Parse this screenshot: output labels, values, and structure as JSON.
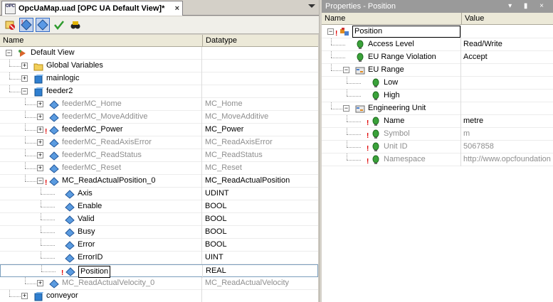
{
  "left_panel": {
    "tab_title": "OpcUaMap.uad [OPC UA Default View]*",
    "tab_close": "×",
    "opc_icon_text": "OPC",
    "columns": {
      "name": "Name",
      "datatype": "Datatype"
    },
    "toolbar": [
      "remove-icon",
      "add-icon",
      "tag-icon",
      "check-icon",
      "binoculars-icon"
    ],
    "tree": [
      {
        "name": "Default View",
        "type": "",
        "level": 0,
        "exp": "−",
        "icon": "view-icon",
        "warn": false,
        "dim": false
      },
      {
        "name": "Global Variables",
        "type": "",
        "level": 1,
        "exp": "+",
        "icon": "folder-icon",
        "warn": false,
        "dim": false
      },
      {
        "name": "mainlogic",
        "type": "",
        "level": 1,
        "exp": "+",
        "icon": "cube-icon",
        "warn": false,
        "dim": false
      },
      {
        "name": "feeder2",
        "type": "",
        "level": 1,
        "exp": "−",
        "icon": "cube-icon",
        "warn": false,
        "dim": false
      },
      {
        "name": "feederMC_Home",
        "type": "MC_Home",
        "level": 2,
        "exp": "+",
        "icon": "diamond-icon",
        "warn": false,
        "dim": true
      },
      {
        "name": "feederMC_MoveAdditive",
        "type": "MC_MoveAdditive",
        "level": 2,
        "exp": "+",
        "icon": "diamond-icon",
        "warn": false,
        "dim": true
      },
      {
        "name": "feederMC_Power",
        "type": "MC_Power",
        "level": 2,
        "exp": "+",
        "icon": "diamond-icon",
        "warn": true,
        "dim": false
      },
      {
        "name": "feederMC_ReadAxisError",
        "type": "MC_ReadAxisError",
        "level": 2,
        "exp": "+",
        "icon": "diamond-icon",
        "warn": false,
        "dim": true
      },
      {
        "name": "feederMC_ReadStatus",
        "type": "MC_ReadStatus",
        "level": 2,
        "exp": "+",
        "icon": "diamond-icon",
        "warn": false,
        "dim": true
      },
      {
        "name": "feederMC_Reset",
        "type": "MC_Reset",
        "level": 2,
        "exp": "+",
        "icon": "diamond-icon",
        "warn": false,
        "dim": true
      },
      {
        "name": "MC_ReadActualPosition_0",
        "type": "MC_ReadActualPosition",
        "level": 2,
        "exp": "−",
        "icon": "diamond-icon",
        "warn": true,
        "dim": false
      },
      {
        "name": "Axis",
        "type": "UDINT",
        "level": 3,
        "exp": "",
        "icon": "diamond-icon",
        "warn": false,
        "dim": false
      },
      {
        "name": "Enable",
        "type": "BOOL",
        "level": 3,
        "exp": "",
        "icon": "diamond-icon",
        "warn": false,
        "dim": false
      },
      {
        "name": "Valid",
        "type": "BOOL",
        "level": 3,
        "exp": "",
        "icon": "diamond-icon",
        "warn": false,
        "dim": false
      },
      {
        "name": "Busy",
        "type": "BOOL",
        "level": 3,
        "exp": "",
        "icon": "diamond-icon",
        "warn": false,
        "dim": false
      },
      {
        "name": "Error",
        "type": "BOOL",
        "level": 3,
        "exp": "",
        "icon": "diamond-icon",
        "warn": false,
        "dim": false
      },
      {
        "name": "ErrorID",
        "type": "UINT",
        "level": 3,
        "exp": "",
        "icon": "diamond-icon",
        "warn": false,
        "dim": false
      },
      {
        "name": "Position",
        "type": "REAL",
        "level": 3,
        "exp": "",
        "icon": "diamond-icon",
        "warn": true,
        "dim": false,
        "selected": true
      },
      {
        "name": "MC_ReadActualVelocity_0",
        "type": "MC_ReadActualVelocity",
        "level": 2,
        "exp": "+",
        "icon": "diamond-icon",
        "warn": false,
        "dim": true
      },
      {
        "name": "conveyor",
        "type": "",
        "level": 1,
        "exp": "+",
        "icon": "cube-icon",
        "warn": false,
        "dim": false
      }
    ]
  },
  "right_panel": {
    "title": "Properties - Position",
    "controls": "▾ ▮ ×",
    "columns": {
      "name": "Name",
      "value": "Value"
    },
    "rows": [
      {
        "name": "Position",
        "value": "",
        "level": 0,
        "exp": "−",
        "icon": "node-icon",
        "warn": true,
        "dim": false,
        "edit": true
      },
      {
        "name": "Access Level",
        "value": "Read/Write",
        "level": 1,
        "exp": "",
        "icon": "bulb-icon",
        "warn": false,
        "dim": false
      },
      {
        "name": "EU Range Violation",
        "value": "Accept",
        "level": 1,
        "exp": "",
        "icon": "bulb-icon",
        "warn": false,
        "dim": false
      },
      {
        "name": "EU Range",
        "value": "",
        "level": 1,
        "exp": "−",
        "icon": "struct-icon",
        "warn": false,
        "dim": false
      },
      {
        "name": "Low",
        "value": "",
        "level": 2,
        "exp": "",
        "icon": "bulb-icon",
        "warn": false,
        "dim": false
      },
      {
        "name": "High",
        "value": "",
        "level": 2,
        "exp": "",
        "icon": "bulb-icon",
        "warn": false,
        "dim": false
      },
      {
        "name": "Engineering Unit",
        "value": "",
        "level": 1,
        "exp": "−",
        "icon": "struct-icon",
        "warn": false,
        "dim": false
      },
      {
        "name": "Name",
        "value": "metre",
        "level": 2,
        "exp": "",
        "icon": "bulb-icon",
        "warn": true,
        "dim": false
      },
      {
        "name": "Symbol",
        "value": "m",
        "level": 2,
        "exp": "",
        "icon": "bulb-icon",
        "warn": true,
        "dim": true
      },
      {
        "name": "Unit ID",
        "value": "5067858",
        "level": 2,
        "exp": "",
        "icon": "bulb-icon",
        "warn": true,
        "dim": true
      },
      {
        "name": "Namespace",
        "value": "http://www.opcfoundation",
        "level": 2,
        "exp": "",
        "icon": "bulb-icon",
        "warn": true,
        "dim": true
      }
    ]
  },
  "colors": {
    "accent_blue": "#2f6fb8",
    "dim_text": "#8e8e8e",
    "warn_red": "#e00000",
    "bulb_green": "#3aa23a"
  }
}
